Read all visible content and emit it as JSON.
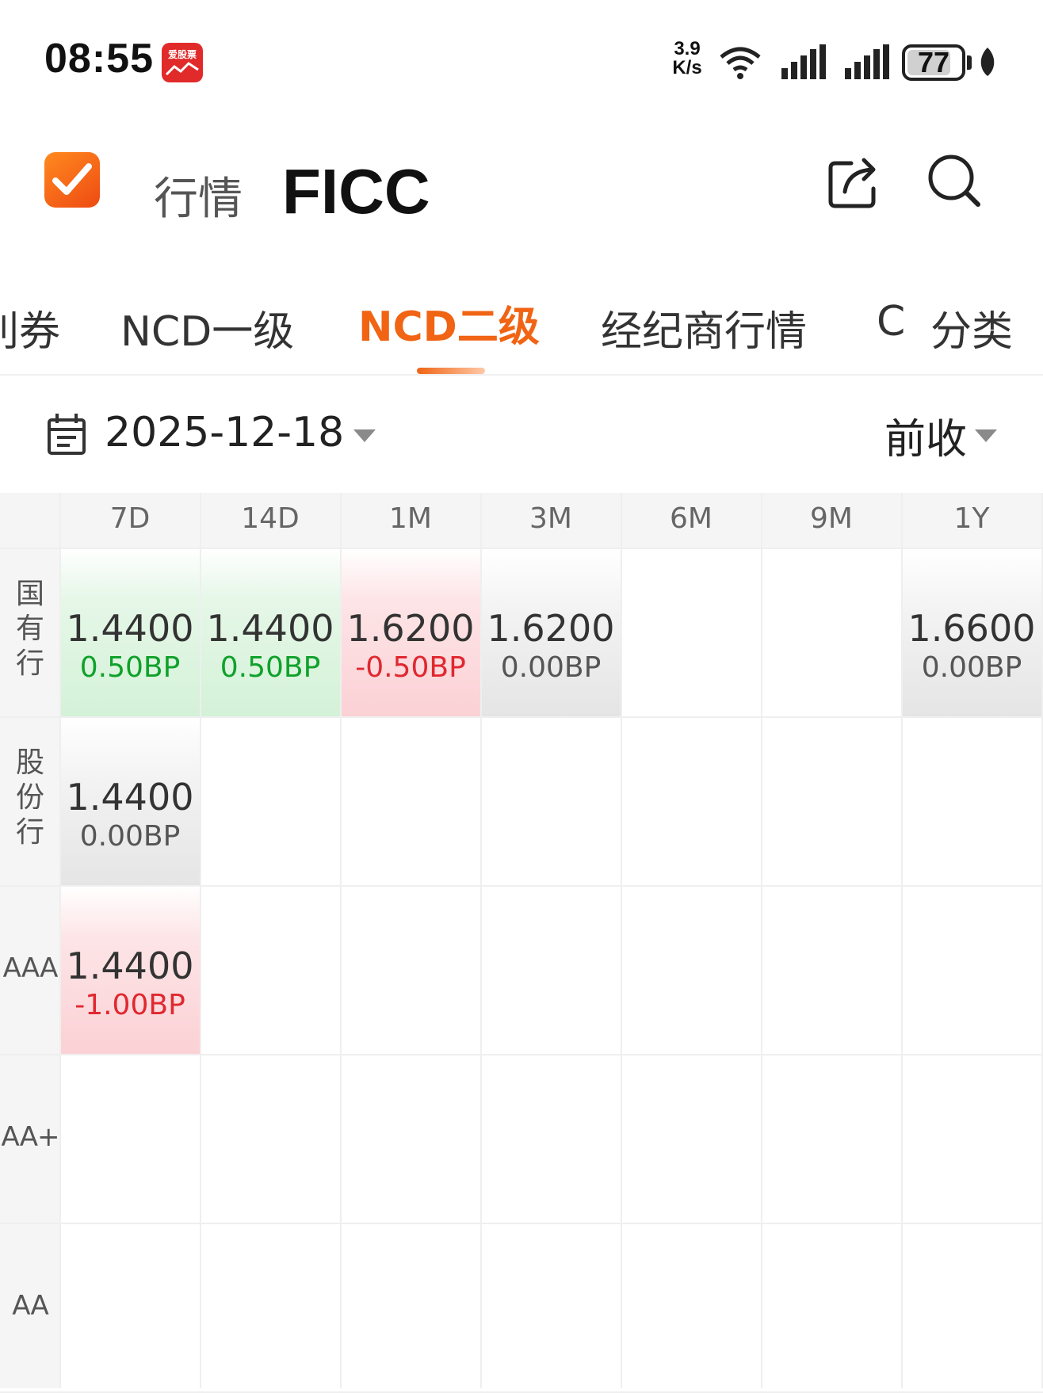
{
  "status_bar": {
    "time": "08:55",
    "app_icon_text": "爱股票",
    "net_speed_value": "3.9",
    "net_speed_unit": "K/s",
    "battery": "77"
  },
  "header": {
    "nav_label": "行情",
    "title": "FICC"
  },
  "tabs": [
    {
      "label": "利券"
    },
    {
      "label": "NCD一级"
    },
    {
      "label": "NCD二级"
    },
    {
      "label": "经纪商行情"
    },
    {
      "label": "C"
    },
    {
      "label": "分类"
    }
  ],
  "active_tab": "NCD二级",
  "filter": {
    "date": "2025-12-18",
    "price_type": "前收"
  },
  "grid": {
    "columns": [
      "7D",
      "14D",
      "1M",
      "3M",
      "6M",
      "9M",
      "1Y"
    ],
    "rows": [
      {
        "label": "国有行",
        "cells": [
          {
            "value": "1.4400",
            "change": "0.50BP",
            "trend": "down"
          },
          {
            "value": "1.4400",
            "change": "0.50BP",
            "trend": "down"
          },
          {
            "value": "1.6200",
            "change": "-0.50BP",
            "trend": "up"
          },
          {
            "value": "1.6200",
            "change": "0.00BP",
            "trend": "flat"
          },
          null,
          null,
          {
            "value": "1.6600",
            "change": "0.00BP",
            "trend": "flat"
          }
        ]
      },
      {
        "label": "股份行",
        "cells": [
          {
            "value": "1.4400",
            "change": "0.00BP",
            "trend": "flat"
          },
          null,
          null,
          null,
          null,
          null,
          null
        ]
      },
      {
        "label": "AAA",
        "cells": [
          {
            "value": "1.4400",
            "change": "-1.00BP",
            "trend": "up"
          },
          null,
          null,
          null,
          null,
          null,
          null
        ]
      },
      {
        "label": "AA+",
        "cells": [
          null,
          null,
          null,
          null,
          null,
          null,
          null
        ]
      },
      {
        "label": "AA",
        "cells": [
          null,
          null,
          null,
          null,
          null,
          null,
          null
        ]
      }
    ]
  },
  "colors": {
    "accent": "#f06414",
    "up_red": "#e0282f",
    "down_green": "#10a12a",
    "header_bg": "#f5f5f5"
  },
  "icons": {
    "logo": "check-icon",
    "share": "share-icon",
    "search": "search-icon",
    "calendar": "calendar-icon"
  }
}
